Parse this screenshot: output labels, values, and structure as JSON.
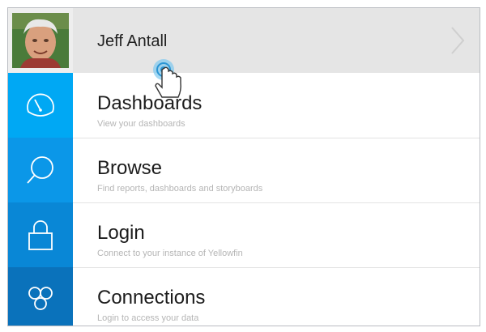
{
  "user": {
    "name": "Jeff Antall"
  },
  "menu": {
    "items": [
      {
        "title": "Dashboards",
        "subtitle": "View your dashboards",
        "icon": "dashboard-gauge-icon",
        "color": "#00a8f4"
      },
      {
        "title": "Browse",
        "subtitle": "Find reports, dashboards and storyboards",
        "icon": "search-icon",
        "color": "#0b97e8"
      },
      {
        "title": "Login",
        "subtitle": "Connect to your instance of Yellowfin",
        "icon": "lock-icon",
        "color": "#0987d6"
      },
      {
        "title": "Connections",
        "subtitle": "Login to access your data",
        "icon": "connections-icon",
        "color": "#0a72bb"
      }
    ]
  },
  "colors": {
    "header_bg": "#e5e5e5",
    "text": "#1c1c1c",
    "subtitle": "#b5b5b5"
  }
}
